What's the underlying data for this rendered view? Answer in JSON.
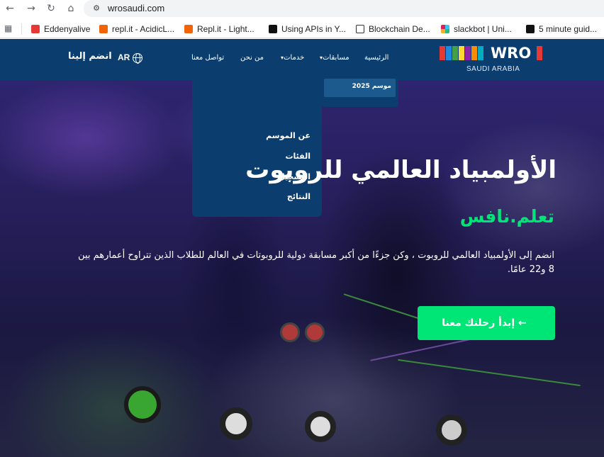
{
  "browser": {
    "back_icon": "arrow-left-icon",
    "forward_icon": "arrow-right-icon",
    "reload_icon": "reload-icon",
    "home_icon": "home-icon",
    "site_info_icon": "site-info-icon",
    "url": "wrosaudi.com",
    "bookmarks": [
      {
        "label": "Eddenyalive",
        "color": "#e53935"
      },
      {
        "label": "repl.it - AcidicL...",
        "color": "#f26207"
      },
      {
        "label": "Repl.it - Light...",
        "color": "#f26207"
      },
      {
        "label": "Using APIs in Y...",
        "color": "#111111"
      },
      {
        "label": "Blockchain De...",
        "color": "#333333"
      },
      {
        "label": "slackbot | Uni...",
        "color": "#4a154b"
      },
      {
        "label": "5 minute guid...",
        "color": "#111111"
      }
    ]
  },
  "site": {
    "logo": {
      "text": "WRO",
      "sub": "SAUDI ARABIA"
    },
    "nav": {
      "home": "الرئيسية",
      "competitions": "مسابقات",
      "services": "خدمات",
      "about": "من نحن",
      "contact": "تواصل معنا",
      "lang": "AR",
      "join": "انضم إلينا"
    },
    "season_menu": {
      "label": "موسم 2025"
    },
    "dropdown": [
      "عن الموسم",
      "الفئات",
      "التسجيل",
      "النتائج"
    ],
    "hero": {
      "title": "الأولمبياد العالمي للروبوت",
      "tagline": "تعلم.نافس",
      "description": "انضم إلى الأولمبياد العالمي للروبوت ، وكن جزءًا من أكبر مسابقة دولية للروبوتات في العالم للطلاب الذين تتراوح أعمارهم بين 8 و22 عامًا.",
      "cta": "إبدأ رحلتك معنا"
    },
    "colors": {
      "navbar": "#0b3d6e",
      "accent_green": "#00e676",
      "submenu_active": "#1c5a8e"
    }
  }
}
